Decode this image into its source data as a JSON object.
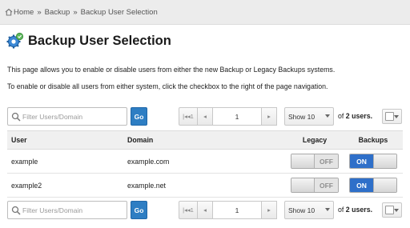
{
  "breadcrumb": {
    "items": [
      "Home",
      "Backup",
      "Backup User Selection"
    ],
    "separator": "»"
  },
  "page": {
    "title": "Backup User Selection",
    "description1": "This page allows you to enable or disable users from either the new Backup or Legacy Backups systems.",
    "description2": "To enable or disable all users from either system, click the checkbox to the right of the page navigation."
  },
  "toolbar": {
    "filter_placeholder": "Filter Users/Domain",
    "go_label": "Go",
    "first_label": "|◂◂1",
    "prev_label": "◂",
    "page_value": "1",
    "next_label": "▸",
    "last_label": "1▸▸|",
    "show_label": "Show 10",
    "count_prefix": "of",
    "count_bold": "2 users."
  },
  "table": {
    "headers": [
      "User",
      "Domain",
      "Legacy",
      "Backups"
    ],
    "rows": [
      {
        "user": "example",
        "domain": "example.com",
        "legacy": "OFF",
        "backups": "ON"
      },
      {
        "user": "example2",
        "domain": "example.net",
        "legacy": "OFF",
        "backups": "ON"
      }
    ]
  },
  "colors": {
    "accent": "#2e7ec3",
    "toggle_on": "#2e6fc9",
    "breadcrumb_bg": "#ececec"
  },
  "icons": [
    "home-icon",
    "backup-gear-icon",
    "search-icon",
    "chevron-down-icon",
    "checkbox-icon"
  ]
}
